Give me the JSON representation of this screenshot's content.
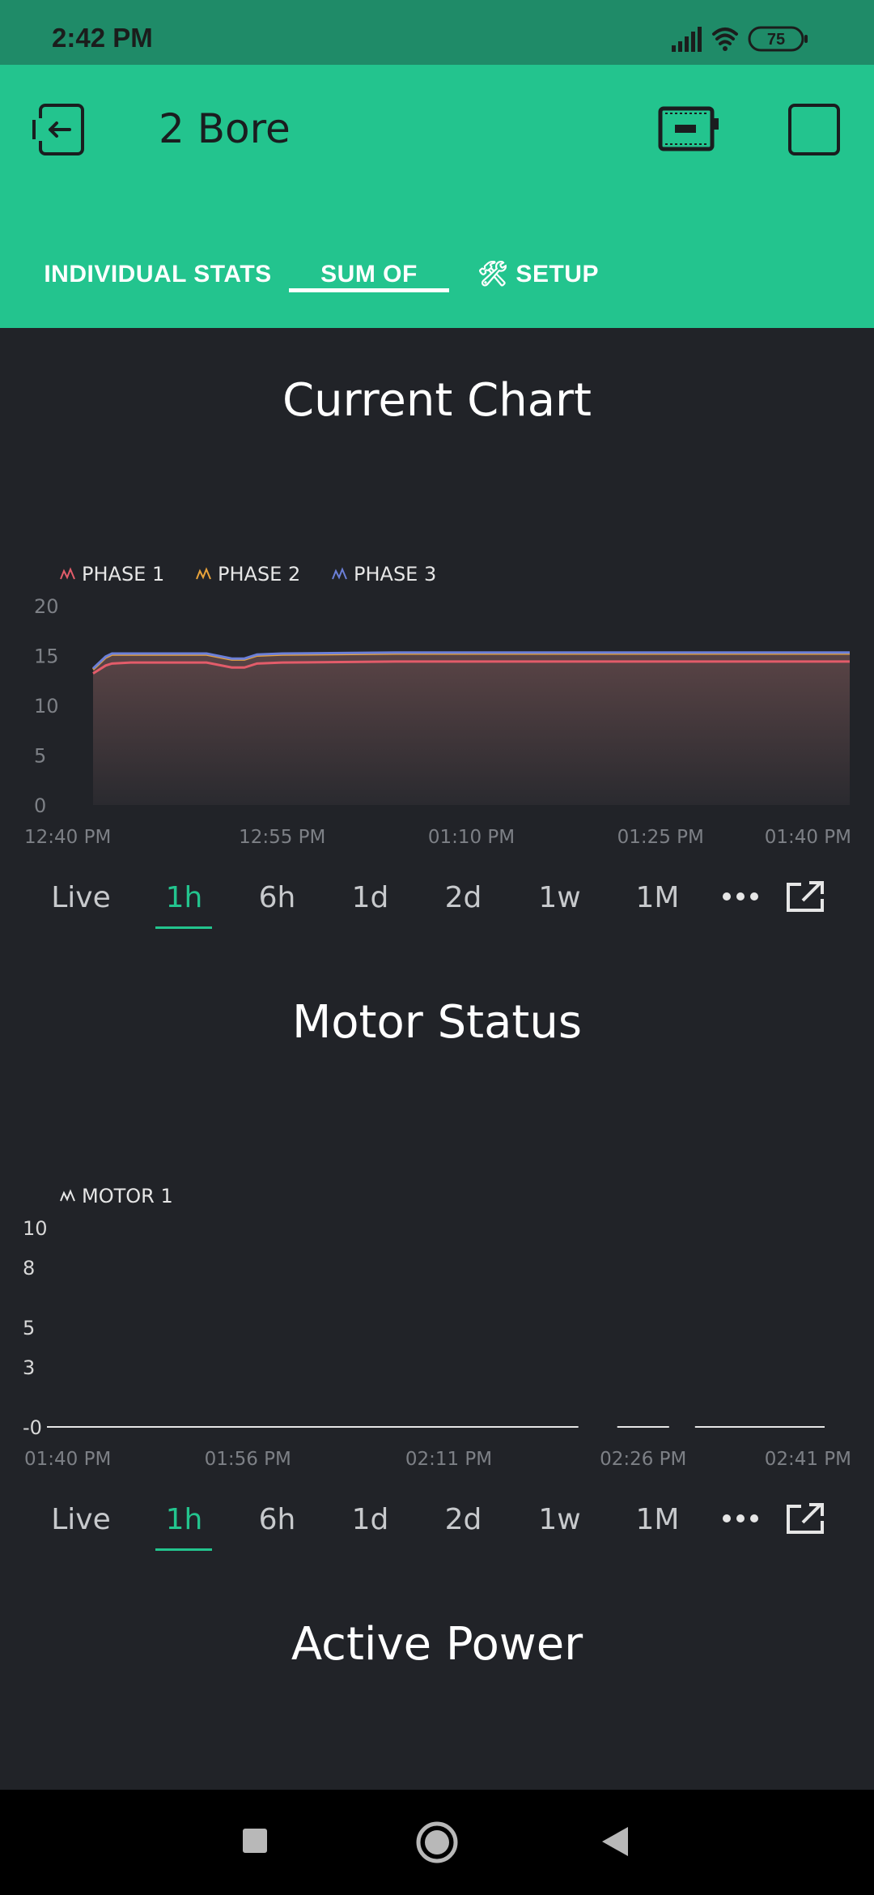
{
  "status_bar": {
    "time": "2:42 PM",
    "battery": "75",
    "icons": [
      "signal-icon",
      "wifi-icon",
      "battery-icon"
    ]
  },
  "app_bar": {
    "title": "2 Bore",
    "icons": [
      "back-icon",
      "device-icon",
      "square-icon"
    ]
  },
  "tabs": [
    {
      "label": "INDIVIDUAL STATS",
      "active": false
    },
    {
      "label": "SUM OF",
      "active": true
    },
    {
      "label": "🛠 SETUP",
      "active": false
    }
  ],
  "colors": {
    "accent": "#23c48e",
    "header": "#23c48e",
    "statusbar": "#1f8b68",
    "background": "#212328",
    "phase1": "#e35c6a",
    "phase2": "#e8a33b",
    "phase3": "#6b7fd8",
    "motor1": "#e6e6e6"
  },
  "sections": {
    "current_chart": {
      "title": "Current Chart"
    },
    "motor_status": {
      "title": "Motor Status"
    },
    "active_power": {
      "title": "Active Power"
    }
  },
  "time_ranges": {
    "items": [
      "Live",
      "1h",
      "6h",
      "1d",
      "2d",
      "1w",
      "1M"
    ],
    "active": "1h",
    "more_icon": "more-dots-icon",
    "expand_icon": "open-external-icon"
  },
  "chart_data": [
    {
      "type": "area",
      "title": "",
      "x_tick_labels": [
        "12:40 PM",
        "12:55 PM",
        "01:10 PM",
        "01:25 PM",
        "01:40 PM"
      ],
      "x_minutes": [
        0,
        15,
        30,
        45,
        60
      ],
      "ylim": [
        0,
        20
      ],
      "y_ticks": [
        0,
        5,
        10,
        15,
        20
      ],
      "legend": "top-left",
      "grid": false,
      "series": [
        {
          "name": "PHASE 1",
          "color": "#e35c6a",
          "x": [
            0,
            1,
            1.5,
            3,
            9,
            11,
            12,
            13,
            15,
            24,
            60
          ],
          "values": [
            13.2,
            14.0,
            14.2,
            14.3,
            14.3,
            13.8,
            13.8,
            14.2,
            14.3,
            14.4,
            14.4
          ]
        },
        {
          "name": "PHASE 2",
          "color": "#e8a33b",
          "x": [
            0,
            1,
            1.5,
            3,
            9,
            11,
            12,
            13,
            15,
            24,
            60
          ],
          "values": [
            13.6,
            14.8,
            15.1,
            15.1,
            15.1,
            14.6,
            14.6,
            15.0,
            15.1,
            15.2,
            15.2
          ]
        },
        {
          "name": "PHASE 3",
          "color": "#6b7fd8",
          "x": [
            0,
            1,
            1.5,
            3,
            9,
            11,
            12,
            13,
            15,
            24,
            60
          ],
          "values": [
            13.7,
            14.9,
            15.2,
            15.2,
            15.2,
            14.7,
            14.7,
            15.1,
            15.2,
            15.3,
            15.3
          ]
        }
      ]
    },
    {
      "type": "line",
      "title": "",
      "x_tick_labels": [
        "01:40 PM",
        "01:56 PM",
        "02:11 PM",
        "02:26 PM",
        "02:41 PM"
      ],
      "x_minutes": [
        0,
        15.5,
        31,
        46,
        61
      ],
      "ylim": [
        0,
        10
      ],
      "y_ticks": [
        0,
        3,
        5,
        8,
        10
      ],
      "y_tick_labels": [
        "-0",
        "3",
        "5",
        "8",
        "10"
      ],
      "legend": "top-left",
      "grid": false,
      "series": [
        {
          "name": "MOTOR 1",
          "color": "#e6e6e6",
          "segments": [
            {
              "x": [
                0,
                41
              ],
              "values": [
                0,
                0
              ]
            },
            {
              "x": [
                44,
                48
              ],
              "values": [
                0,
                0
              ]
            },
            {
              "x": [
                50,
                60
              ],
              "values": [
                0,
                0
              ]
            }
          ]
        }
      ]
    }
  ]
}
